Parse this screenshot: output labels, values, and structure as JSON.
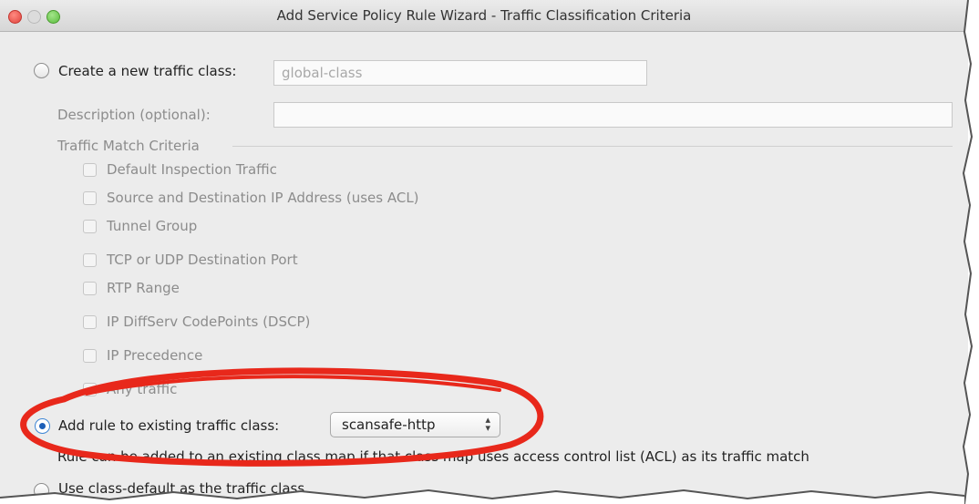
{
  "window": {
    "title": "Add Service Policy Rule Wizard - Traffic Classification Criteria"
  },
  "create_class": {
    "label": "Create a new traffic class:",
    "value": "global-class",
    "description_label": "Description (optional):",
    "description_value": ""
  },
  "match_criteria": {
    "heading": "Traffic Match Criteria",
    "items": [
      {
        "label": "Default Inspection Traffic",
        "checked": false
      },
      {
        "label": "Source and Destination IP Address (uses ACL)",
        "checked": false
      },
      {
        "label": "Tunnel Group",
        "checked": false
      },
      {
        "label": "TCP or UDP Destination Port",
        "checked": false
      },
      {
        "label": "RTP Range",
        "checked": false
      },
      {
        "label": "IP DiffServ CodePoints (DSCP)",
        "checked": false
      },
      {
        "label": "IP Precedence",
        "checked": false
      },
      {
        "label": "Any traffic",
        "checked": false
      }
    ]
  },
  "existing_class": {
    "label": "Add rule to existing traffic class:",
    "selected": "scansafe-http",
    "note": "Rule can be added to an existing class map if that class map uses access control list (ACL) as its traffic match"
  },
  "class_default": {
    "label": "Use class-default as the traffic class."
  },
  "annotation": {
    "color": "#e8281b"
  }
}
